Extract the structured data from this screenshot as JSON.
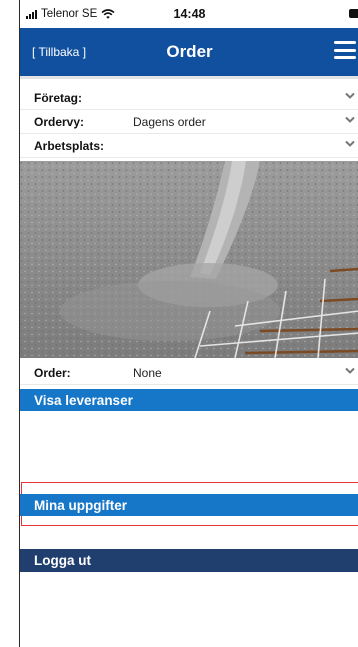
{
  "status_bar": {
    "carrier": "Telenor SE",
    "time": "14:48",
    "icons": [
      "signal-icon",
      "wifi-icon",
      "battery-icon"
    ]
  },
  "navbar": {
    "back_label": "[ Tillbaka ]",
    "title": "Order",
    "menu_icon": "hamburger-menu-icon"
  },
  "fields": {
    "company": {
      "label": "Företag:",
      "value": ""
    },
    "order_view": {
      "label": "Ordervy:",
      "value": "Dagens order"
    },
    "workplace": {
      "label": "Arbetsplats:",
      "value": ""
    },
    "order": {
      "label": "Order:",
      "value": "None"
    }
  },
  "buttons": {
    "deliveries": "Visa leveranser",
    "my_details": "Mina uppgifter",
    "logout": "Logga ut"
  },
  "colors": {
    "navbar": "#10509f",
    "button_blue": "#1676c8",
    "button_navy": "#213f6e",
    "highlight": "#e53535"
  }
}
